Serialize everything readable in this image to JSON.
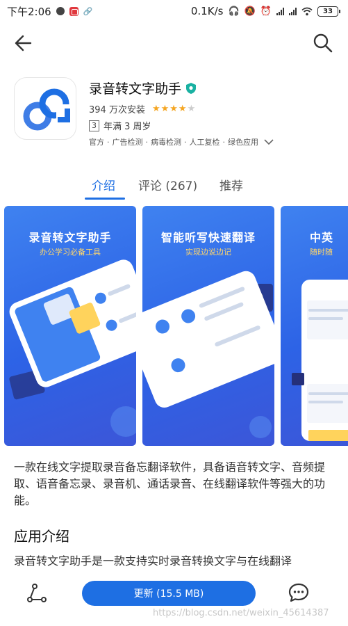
{
  "status_bar": {
    "time": "下午2:06",
    "net_speed": "0.1K/s",
    "battery": "33"
  },
  "app": {
    "name": "录音转文字助手",
    "installs": "394 万次安装",
    "rating_stars": 4,
    "rating_max": 5,
    "age_number": "3",
    "age_text": "年满 3 周岁",
    "certs": [
      "官方",
      "广告检测",
      "病毒检测",
      "人工复检",
      "绿色应用"
    ],
    "cert_sep": "·"
  },
  "tabs": [
    {
      "label": "介绍",
      "active": true
    },
    {
      "label": "评论 (267)",
      "active": false
    },
    {
      "label": "推荐",
      "active": false
    }
  ],
  "screenshots": [
    {
      "title": "录音转文字助手",
      "subtitle": "办公学习必备工具"
    },
    {
      "title": "智能听写快速翻译",
      "subtitle": "实现边说边记"
    },
    {
      "title": "中英",
      "subtitle": "随时随"
    }
  ],
  "description": "一款在线文字提取录音备忘翻译软件，具备语音转文字、音频提取、语音备忘录、录音机、通话录音、在线翻译软件等强大的功能。",
  "section_title": "应用介绍",
  "intro_text": "录音转文字助手是一款支持实时录音转换文字与在线翻译",
  "bottom": {
    "update_label": "更新 (15.5 MB)",
    "watermark": "https://blog.csdn.net/weixin_45614387"
  },
  "colors": {
    "accent": "#1e6fe3",
    "star": "#f5a623",
    "screenshot_bg": "#3f82f0"
  }
}
